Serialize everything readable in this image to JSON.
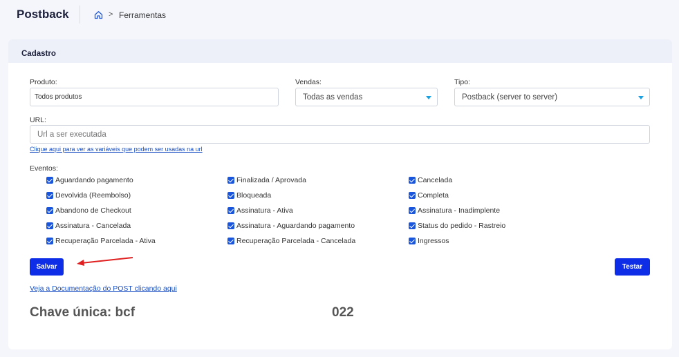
{
  "header": {
    "title": "Postback",
    "breadcrumb_separator": ">",
    "breadcrumb_current": "Ferramentas"
  },
  "card": {
    "title": "Cadastro"
  },
  "form": {
    "produto": {
      "label": "Produto:",
      "value": "Todos produtos"
    },
    "vendas": {
      "label": "Vendas:",
      "value": "Todas as vendas"
    },
    "tipo": {
      "label": "Tipo:",
      "value": "Postback (server to server)"
    },
    "url": {
      "label": "URL:",
      "placeholder": "Url a ser executada"
    },
    "variables_link": "Clique aqui para ver as variáveis que podem ser usadas na url",
    "eventos_label": "Eventos:"
  },
  "events": {
    "col1": [
      {
        "label": "Aguardando pagamento",
        "checked": true
      },
      {
        "label": "Devolvida (Reembolso)",
        "checked": true
      },
      {
        "label": "Abandono de Checkout",
        "checked": true
      },
      {
        "label": "Assinatura - Cancelada",
        "checked": true
      },
      {
        "label": "Recuperação Parcelada - Ativa",
        "checked": true
      }
    ],
    "col2": [
      {
        "label": "Finalizada / Aprovada",
        "checked": true
      },
      {
        "label": "Bloqueada",
        "checked": true
      },
      {
        "label": "Assinatura - Ativa",
        "checked": true
      },
      {
        "label": "Assinatura - Aguardando pagamento",
        "checked": true
      },
      {
        "label": "Recuperação Parcelada - Cancelada",
        "checked": true
      }
    ],
    "col3": [
      {
        "label": "Cancelada",
        "checked": true
      },
      {
        "label": "Completa",
        "checked": true
      },
      {
        "label": "Assinatura - Inadimplente",
        "checked": true
      },
      {
        "label": "Status do pedido - Rastreio",
        "checked": true
      },
      {
        "label": "Ingressos",
        "checked": true
      }
    ]
  },
  "buttons": {
    "save": "Salvar",
    "test": "Testar"
  },
  "doc_link": "Veja a Documentação do POST clicando aqui",
  "key": {
    "label": "Chave única: bcf",
    "value_suffix": "022"
  },
  "colors": {
    "primary_button": "#0d2ee6",
    "checkbox": "#1a56db",
    "caret": "#1aa0e0",
    "annotation_arrow": "#e02020"
  }
}
